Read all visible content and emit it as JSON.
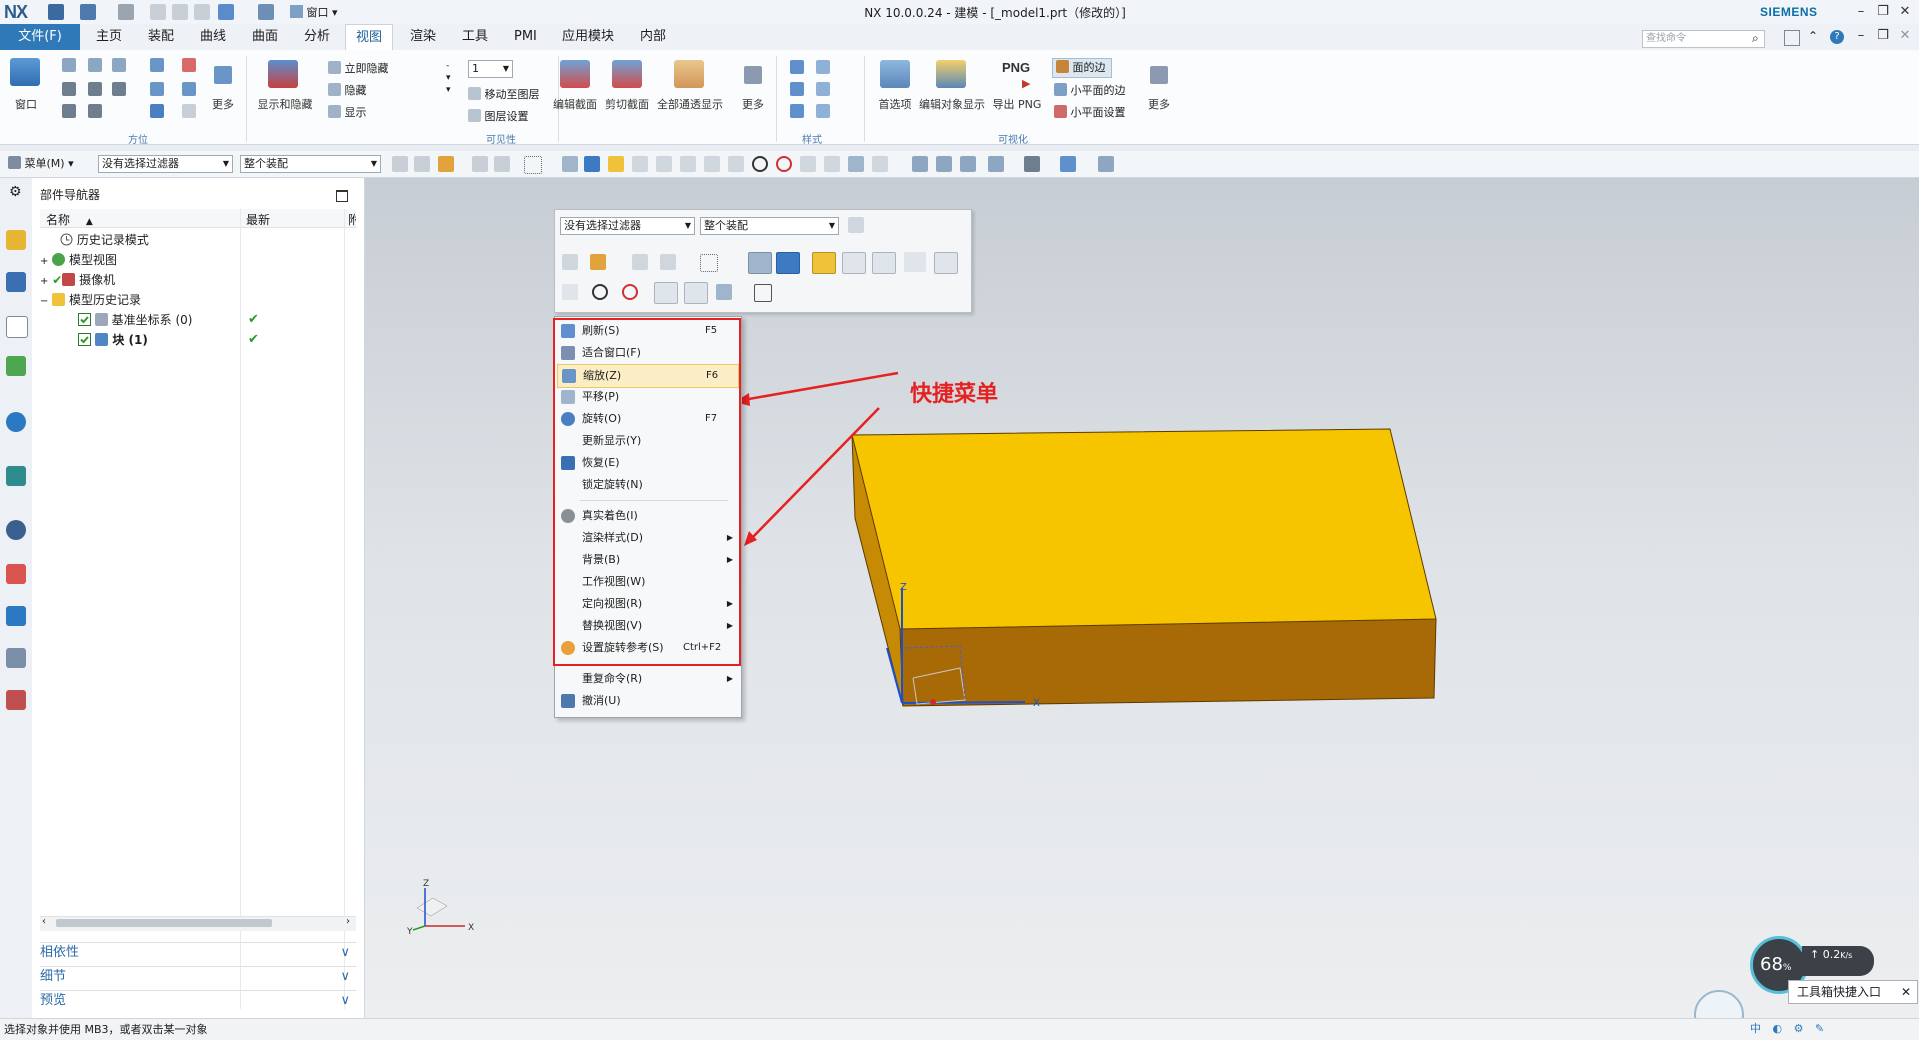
{
  "titlebar": {
    "logo": "NX",
    "window_menu": "窗口",
    "title": "NX 10.0.0.24 - 建模 - [_model1.prt（修改的）]",
    "brand": "SIEMENS"
  },
  "menu": {
    "file": "文件(F)",
    "tabs": [
      "主页",
      "装配",
      "曲线",
      "曲面",
      "分析",
      "视图",
      "渲染",
      "工具",
      "PMI",
      "应用模块",
      "内部"
    ],
    "active_tab": "视图",
    "search_placeholder": "查找命令"
  },
  "ribbon": {
    "window_btn": "窗口",
    "more1": "更多",
    "orientation_group": "方位",
    "show_hide": "显示和隐藏",
    "immediate_hide": "立即隐藏",
    "hide": "隐藏",
    "show": "显示",
    "layer_value": "1",
    "move_to_layer": "移动至图层",
    "layer_settings": "图层设置",
    "visibility_group": "可见性",
    "edit_section": "编辑截面",
    "clip_section": "剪切截面",
    "all_see_through": "全部通透显示",
    "more2": "更多",
    "style_group": "样式",
    "preferences": "首选项",
    "edit_object_display": "编辑对象显示",
    "export_png_icon": "PNG",
    "export_png": "导出 PNG",
    "face_edges": "面的边",
    "small_face_edges": "小平面的边",
    "small_face_settings": "小平面设置",
    "more3": "更多",
    "visualization_group": "可视化"
  },
  "selbar": {
    "menu": "菜单(M)",
    "filter": "没有选择过滤器",
    "assembly": "整个装配"
  },
  "navigator": {
    "title": "部件导航器",
    "col_name": "名称",
    "col_latest": "最新",
    "col_more": "附",
    "items": [
      {
        "label": "历史记录模式",
        "check": ""
      },
      {
        "label": "模型视图",
        "check": ""
      },
      {
        "label": "摄像机",
        "check": ""
      },
      {
        "label": "模型历史记录",
        "check": ""
      },
      {
        "label": "基准坐标系 (0)",
        "check": "✔"
      },
      {
        "label": "块 (1)",
        "check": "✔"
      }
    ],
    "panels": [
      "相依性",
      "细节",
      "预览"
    ]
  },
  "popup_toolbar": {
    "filter": "没有选择过滤器",
    "assembly": "整个装配"
  },
  "context_menu": {
    "items": [
      {
        "label": "刷新(S)",
        "shortcut": "F5",
        "sub": ""
      },
      {
        "label": "适合窗口(F)",
        "shortcut": "",
        "sub": ""
      },
      {
        "label": "缩放(Z)",
        "shortcut": "F6",
        "sub": ""
      },
      {
        "label": "平移(P)",
        "shortcut": "",
        "sub": ""
      },
      {
        "label": "旋转(O)",
        "shortcut": "F7",
        "sub": ""
      },
      {
        "label": "更新显示(Y)",
        "shortcut": "",
        "sub": ""
      },
      {
        "label": "恢复(E)",
        "shortcut": "",
        "sub": ""
      },
      {
        "label": "锁定旋转(N)",
        "shortcut": "",
        "sub": ""
      },
      {
        "label": "真实着色(I)",
        "shortcut": "",
        "sub": ""
      },
      {
        "label": "渲染样式(D)",
        "shortcut": "",
        "sub": "▶"
      },
      {
        "label": "背景(B)",
        "shortcut": "",
        "sub": "▶"
      },
      {
        "label": "工作视图(W)",
        "shortcut": "",
        "sub": ""
      },
      {
        "label": "定向视图(R)",
        "shortcut": "",
        "sub": "▶"
      },
      {
        "label": "替换视图(V)",
        "shortcut": "",
        "sub": "▶"
      },
      {
        "label": "设置旋转参考(S)",
        "shortcut": "Ctrl+F2",
        "sub": ""
      },
      {
        "label": "重复命令(R)",
        "shortcut": "",
        "sub": "▶"
      },
      {
        "label": "撤消(U)",
        "shortcut": "",
        "sub": ""
      }
    ]
  },
  "annotation": "快捷菜单",
  "axes": {
    "x": "X",
    "y": "Y",
    "z": "Z"
  },
  "status": "选择对象并使用 MB3，或者双击某一对象",
  "widget": {
    "percent": "68",
    "percent_unit": "%",
    "speed": "0.2",
    "speed_unit": "K/s",
    "toast": "工具箱快捷入口"
  },
  "colors": {
    "accent": "#2f79b9",
    "block_top": "#f7c400",
    "block_front": "#a86a06",
    "block_side": "#c68a05",
    "annotation": "#e52121"
  }
}
